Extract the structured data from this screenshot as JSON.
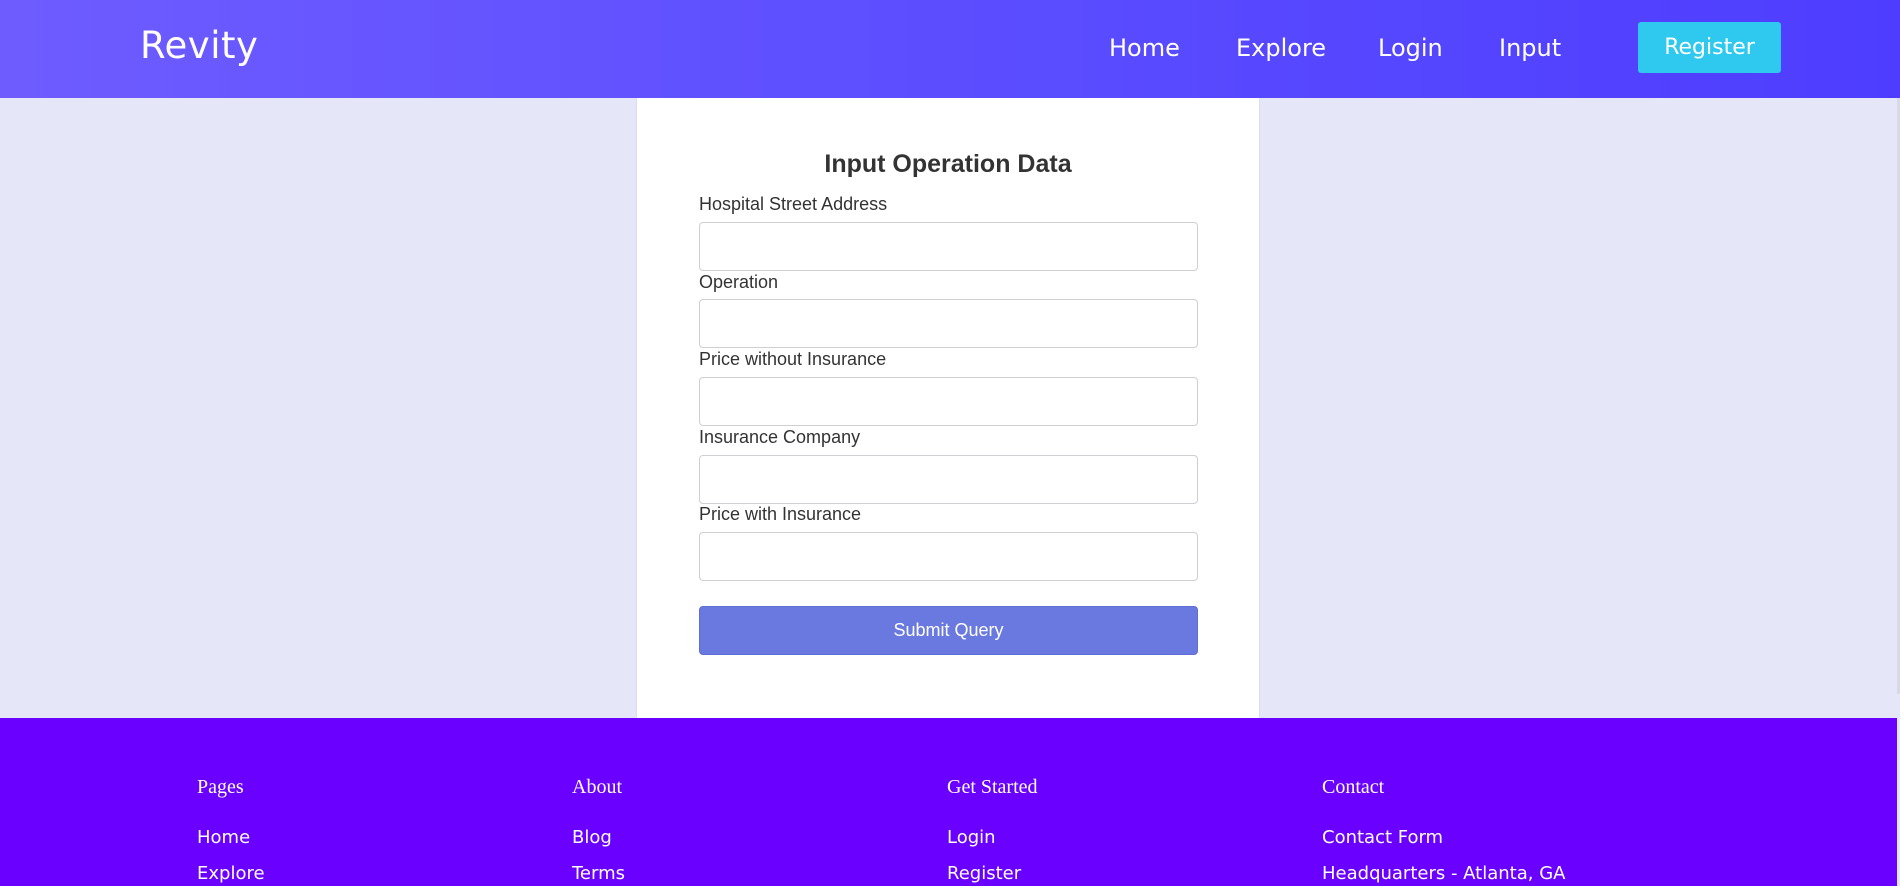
{
  "navbar": {
    "brand": "Revity",
    "links": [
      "Home",
      "Explore",
      "Login",
      "Input"
    ],
    "register_label": "Register"
  },
  "form": {
    "title": "Input Operation Data",
    "fields": [
      {
        "label": "Hospital Street Address",
        "value": ""
      },
      {
        "label": "Operation",
        "value": ""
      },
      {
        "label": "Price without Insurance",
        "value": ""
      },
      {
        "label": "Insurance Company",
        "value": ""
      },
      {
        "label": "Price with Insurance",
        "value": ""
      }
    ],
    "submit_label": "Submit Query"
  },
  "footer": {
    "columns": [
      {
        "heading": "Pages",
        "links": [
          "Home",
          "Explore"
        ]
      },
      {
        "heading": "About",
        "links": [
          "Blog",
          "Terms"
        ]
      },
      {
        "heading": "Get Started",
        "links": [
          "Login",
          "Register"
        ]
      },
      {
        "heading": "Contact",
        "links": [
          "Contact Form",
          "Headquarters - Atlanta, GA"
        ]
      }
    ]
  },
  "colors": {
    "navbar": "#5a4cff",
    "register_button": "#2fc8ee",
    "submit_button": "#6a79df",
    "footer": "#6a00ff",
    "page_background": "#e5e6f8"
  }
}
